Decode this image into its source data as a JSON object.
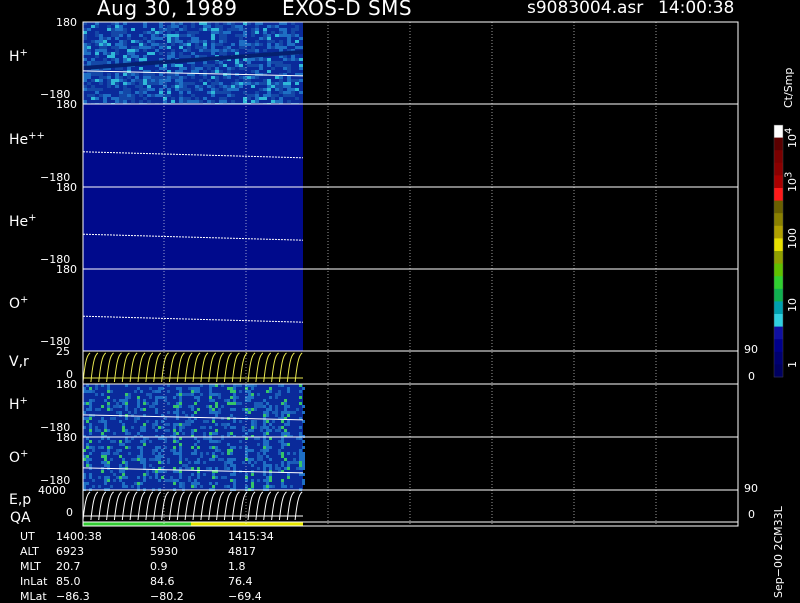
{
  "header": {
    "date": "Aug 30, 1989",
    "instrument": "EXOS-D SMS",
    "filename": "s9083004.asr",
    "time": "14:00:38"
  },
  "colors": {
    "frame": "#ffffff",
    "spectrogram_base": "#000a8c",
    "line_yellow": "#e8e850",
    "qa_green": "#33cc33",
    "qa_yellow": "#e8e800"
  },
  "panels": [
    {
      "id": "h-plus",
      "label": "H",
      "sup": "+",
      "ytop": "180",
      "ybot": "−180"
    },
    {
      "id": "he-plus-plus",
      "label": "He",
      "sup": "++",
      "ytop": "180",
      "ybot": "−180"
    },
    {
      "id": "he-plus",
      "label": "He",
      "sup": "+",
      "ytop": "180",
      "ybot": "−180"
    },
    {
      "id": "o-plus",
      "label": "O",
      "sup": "+",
      "ytop": "180",
      "ybot": "−180"
    },
    {
      "id": "vr",
      "label": "V,r",
      "sup": "",
      "ytop": "25",
      "ybot": "0",
      "rtop": "90",
      "rbot": "0"
    },
    {
      "id": "h-plus-2",
      "label": "H",
      "sup": "+",
      "ytop": "180",
      "ybot": "−180"
    },
    {
      "id": "o-plus-2",
      "label": "O",
      "sup": "+",
      "ytop": "180",
      "ybot": "−180"
    },
    {
      "id": "ep",
      "label": "E,p",
      "sup": "",
      "ytop": "4000",
      "ybot": "0",
      "rtop": "90",
      "rbot": "0"
    }
  ],
  "qa_label": "QA",
  "colorbar": {
    "title": "Ct/Smp",
    "labels": [
      {
        "base": "10",
        "exp": "4"
      },
      {
        "base": "10",
        "exp": "3"
      },
      {
        "base": "100",
        "exp": ""
      },
      {
        "base": "10",
        "exp": ""
      },
      {
        "base": "1",
        "exp": ""
      }
    ]
  },
  "footer": {
    "rows": [
      {
        "key": "UT",
        "vals": [
          "1400:38",
          "1408:06",
          "1415:34"
        ]
      },
      {
        "key": "ALT",
        "vals": [
          "6923",
          "5930",
          "4817"
        ]
      },
      {
        "key": "MLT",
        "vals": [
          "20.7",
          "0.9",
          "1.8"
        ]
      },
      {
        "key": "InLat",
        "vals": [
          "85.0",
          "84.6",
          "76.4"
        ]
      },
      {
        "key": "MLat",
        "vals": [
          "−86.3",
          "−80.2",
          "−69.4"
        ]
      }
    ]
  },
  "side_note": "Sep−00 2CM33L",
  "chart_data": {
    "type": "heatmap",
    "title": "Aug 30, 1989 EXOS-D SMS",
    "x": [
      "1400:38",
      "1408:06",
      "1415:34"
    ],
    "series": [
      {
        "name": "H+",
        "ylim": [
          -180,
          180
        ]
      },
      {
        "name": "He++",
        "ylim": [
          -180,
          180
        ]
      },
      {
        "name": "He+",
        "ylim": [
          -180,
          180
        ]
      },
      {
        "name": "O+",
        "ylim": [
          -180,
          180
        ]
      },
      {
        "name": "V,r",
        "ylim": [
          0,
          25
        ],
        "right_ylim": [
          0,
          90
        ]
      },
      {
        "name": "H+",
        "ylim": [
          -180,
          180
        ]
      },
      {
        "name": "O+",
        "ylim": [
          -180,
          180
        ]
      },
      {
        "name": "E,p",
        "ylim": [
          0,
          4000
        ],
        "right_ylim": [
          0,
          90
        ]
      }
    ],
    "colorbar_unit": "Ct/Smp",
    "colorbar_range": [
      1,
      10000
    ],
    "scale": "log"
  }
}
